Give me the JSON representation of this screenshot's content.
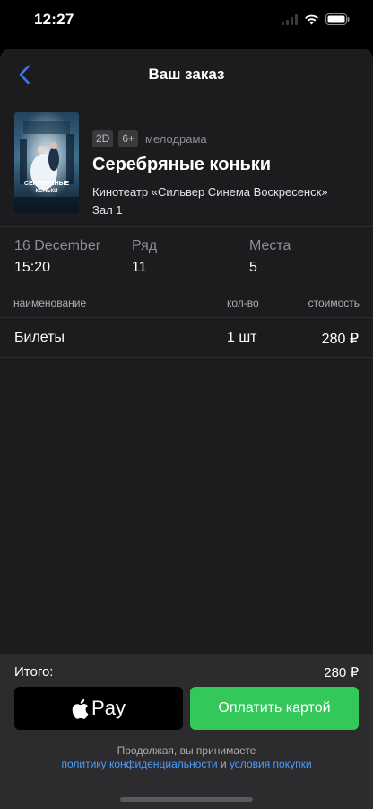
{
  "status": {
    "time": "12:27"
  },
  "nav": {
    "title": "Ваш заказ"
  },
  "movie": {
    "format": "2D",
    "age": "6+",
    "genre": "мелодрама",
    "title": "Серебряные коньки",
    "cinema": "Кинотеатр «Сильвер Синема Воскресенск»",
    "hall": "Зал 1"
  },
  "session": {
    "date": "16 December",
    "time": "15:20",
    "row_label": "Ряд",
    "row": "11",
    "seats_label": "Места",
    "seats": "5"
  },
  "table": {
    "headers": [
      "наименование",
      "кол-во",
      "стоимость"
    ],
    "rows": [
      {
        "name": "Билеты",
        "qty": "1 шт",
        "price": "280 ₽"
      }
    ]
  },
  "footer": {
    "total_label": "Итого:",
    "total_value": "280 ₽",
    "apple_pay_label": "Pay",
    "card_pay_label": "Оплатить картой",
    "legal_prefix": "Продолжая, вы принимаете",
    "privacy_link": "политику конфиденциальности",
    "legal_and": " и ",
    "terms_link": "условия покупки"
  },
  "icons": {
    "back": "chevron-left-icon",
    "apple": "apple-logo-icon",
    "wifi": "wifi-icon",
    "battery": "battery-icon",
    "signal": "signal-icon"
  },
  "colors": {
    "background": "#1c1c1e",
    "accent": "#2f7bf5",
    "pay_button": "#34c759",
    "link": "#4b9bff"
  }
}
